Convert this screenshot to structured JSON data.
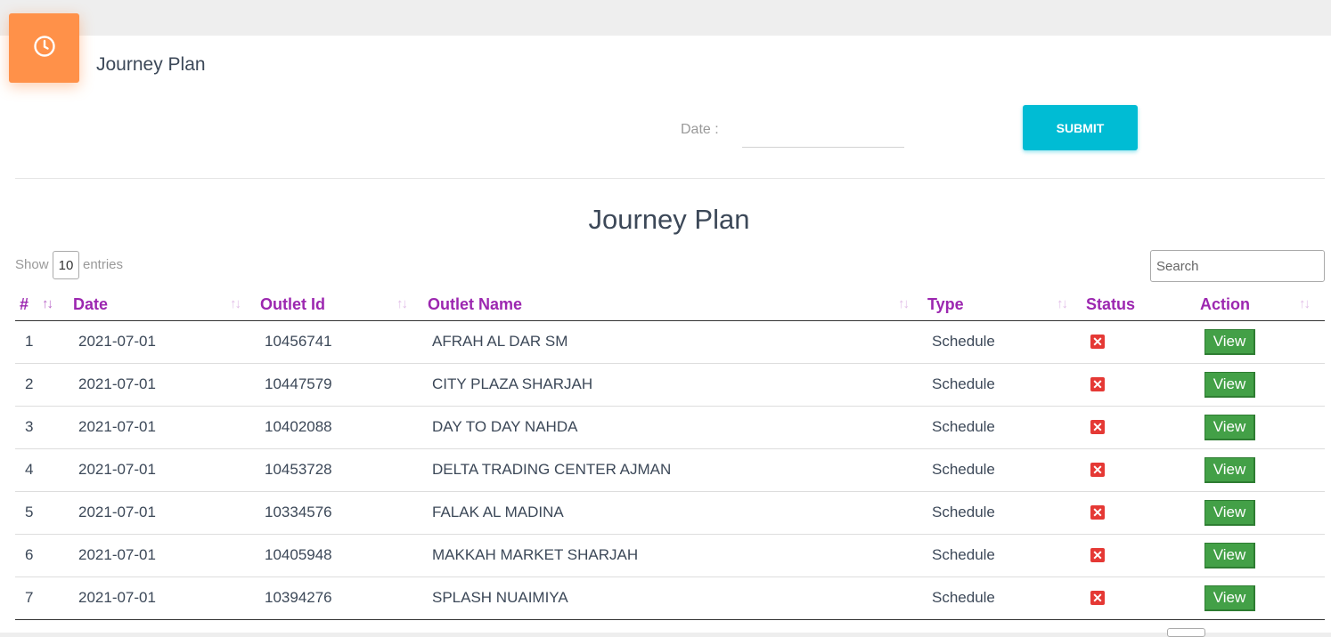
{
  "header": {
    "icon": "clock-icon",
    "title": "Journey Plan",
    "accent_color": "#ff9149"
  },
  "filter": {
    "date_label": "Date :",
    "date_value": "",
    "submit_label": "SUBMIT",
    "submit_color": "#00bcd4"
  },
  "table": {
    "title": "Journey Plan",
    "show_label": "Show",
    "entries_value": "10",
    "entries_label": "entries",
    "search_placeholder": "Search",
    "header_color": "#9c27b0",
    "columns": [
      "#",
      "Date",
      "Outlet Id",
      "Outlet Name",
      "Type",
      "Status",
      "Action"
    ],
    "rows": [
      {
        "num": "1",
        "date": "2021-07-01",
        "outlet_id": "10456741",
        "outlet_name": "AFRAH AL DAR SM",
        "type": "Schedule",
        "status": "x-icon",
        "action": "View"
      },
      {
        "num": "2",
        "date": "2021-07-01",
        "outlet_id": "10447579",
        "outlet_name": "CITY PLAZA SHARJAH",
        "type": "Schedule",
        "status": "x-icon",
        "action": "View"
      },
      {
        "num": "3",
        "date": "2021-07-01",
        "outlet_id": "10402088",
        "outlet_name": "DAY TO DAY NAHDA",
        "type": "Schedule",
        "status": "x-icon",
        "action": "View"
      },
      {
        "num": "4",
        "date": "2021-07-01",
        "outlet_id": "10453728",
        "outlet_name": "DELTA TRADING CENTER AJMAN",
        "type": "Schedule",
        "status": "x-icon",
        "action": "View"
      },
      {
        "num": "5",
        "date": "2021-07-01",
        "outlet_id": "10334576",
        "outlet_name": "FALAK AL MADINA",
        "type": "Schedule",
        "status": "x-icon",
        "action": "View"
      },
      {
        "num": "6",
        "date": "2021-07-01",
        "outlet_id": "10405948",
        "outlet_name": "MAKKAH MARKET SHARJAH",
        "type": "Schedule",
        "status": "x-icon",
        "action": "View"
      },
      {
        "num": "7",
        "date": "2021-07-01",
        "outlet_id": "10394276",
        "outlet_name": "SPLASH NUAIMIYA",
        "type": "Schedule",
        "status": "x-icon",
        "action": "View"
      }
    ]
  }
}
